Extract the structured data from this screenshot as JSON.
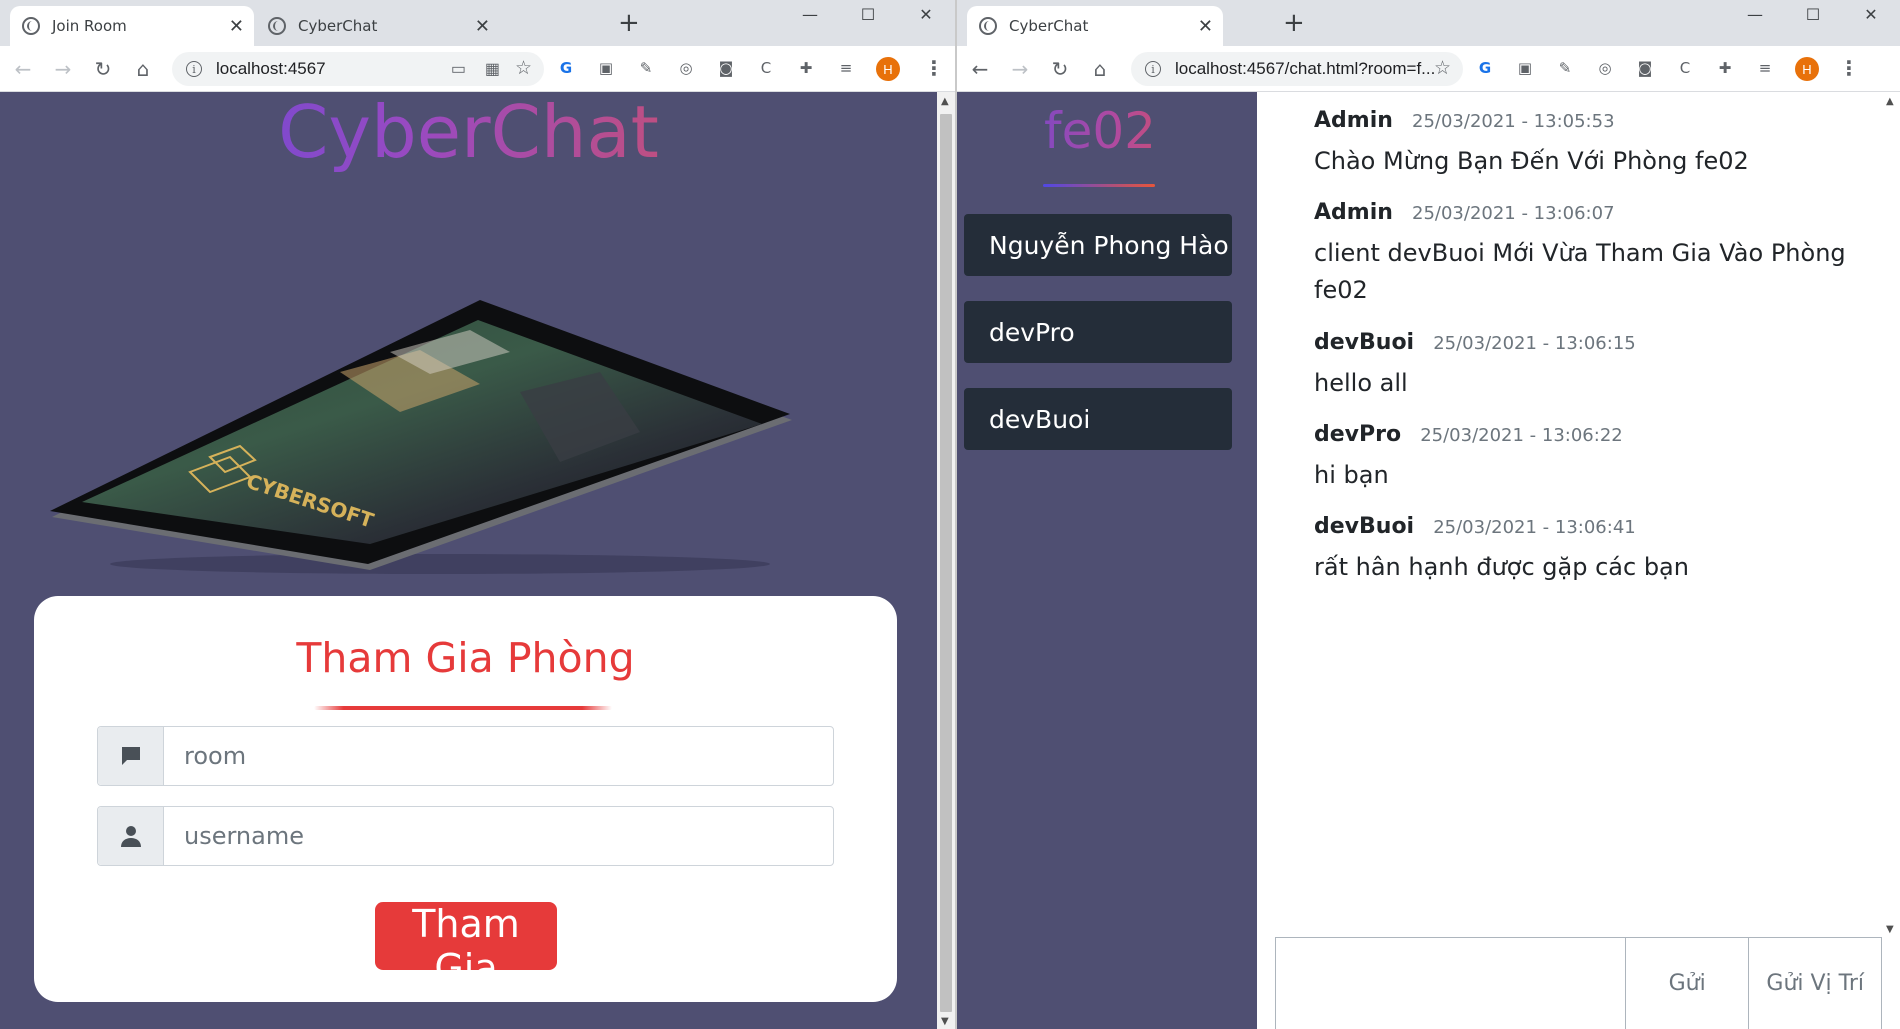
{
  "left_window": {
    "tabs": [
      {
        "title": "Join Room",
        "active": true
      },
      {
        "title": "CyberChat",
        "active": false
      }
    ],
    "url": "localhost:4567",
    "page": {
      "brand": "CyberChat",
      "tablet_brand": "CYBERSOFT",
      "form": {
        "title": "Tham Gia Phòng",
        "room_placeholder": "room",
        "username_placeholder": "username",
        "submit_label": "Tham Gia"
      }
    }
  },
  "right_window": {
    "tabs": [
      {
        "title": "CyberChat",
        "active": true
      }
    ],
    "url": "localhost:4567/chat.html?room=f...",
    "room_name": "fe02",
    "users": [
      "Nguyễn Phong Hào",
      "devPro",
      "devBuoi"
    ],
    "messages": [
      {
        "user": "Admin",
        "time": "25/03/2021 - 13:05:53",
        "text": "Chào Mừng Bạn Đến Với Phòng fe02"
      },
      {
        "user": "Admin",
        "time": "25/03/2021 - 13:06:07",
        "text": "client devBuoi Mới Vừa Tham Gia Vào Phòng fe02"
      },
      {
        "user": "devBuoi",
        "time": "25/03/2021 - 13:06:15",
        "text": "hello all"
      },
      {
        "user": "devPro",
        "time": "25/03/2021 - 13:06:22",
        "text": "hi bạn"
      },
      {
        "user": "devBuoi",
        "time": "25/03/2021 - 13:06:41",
        "text": "rất hân hạnh được gặp các bạn"
      }
    ],
    "compose": {
      "send_label": "Gửi",
      "location_label": "Gửi Vị Trí"
    }
  },
  "profile_initial": "H",
  "colors": {
    "page_bg": "#4f4f72",
    "accent_red": "#e63a3a",
    "user_item_bg": "#242d39",
    "profile_orange": "#e8710a"
  }
}
